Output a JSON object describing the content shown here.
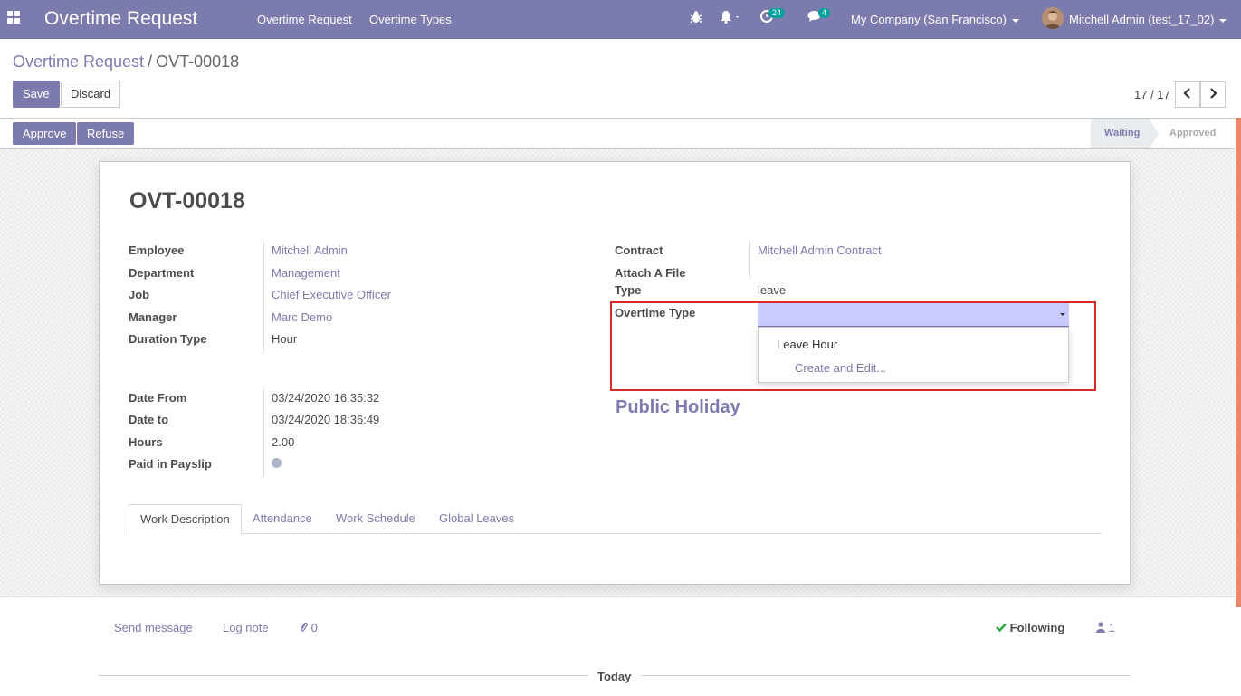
{
  "navbar": {
    "app_title": "Overtime Request",
    "menu": [
      "Overtime Request",
      "Overtime Types"
    ],
    "activities_count": "24",
    "messages_count": "4",
    "company": "My Company (San Francisco)",
    "user": "Mitchell Admin (test_17_02)",
    "bg_color": "#7c7bad"
  },
  "breadcrumb": {
    "parent": "Overtime Request",
    "separator": "/",
    "current": "OVT-00018"
  },
  "actions": {
    "save": "Save",
    "discard": "Discard"
  },
  "pager": {
    "value": "17 / 17"
  },
  "statusbar": {
    "approve": "Approve",
    "refuse": "Refuse",
    "stages": [
      "Waiting",
      "Approved"
    ],
    "active_stage": "Waiting"
  },
  "record": {
    "name": "OVT-00018",
    "left_fields": [
      {
        "label": "Employee",
        "value": "Mitchell Admin",
        "link": true
      },
      {
        "label": "Department",
        "value": "Management",
        "link": true
      },
      {
        "label": "Job",
        "value": "Chief Executive Officer",
        "link": true
      },
      {
        "label": "Manager",
        "value": "Marc Demo",
        "link": true
      },
      {
        "label": "Duration Type",
        "value": "Hour",
        "link": false
      }
    ],
    "date_fields": [
      {
        "label": "Date From",
        "value": "03/24/2020 16:35:32"
      },
      {
        "label": "Date to",
        "value": "03/24/2020 18:36:49"
      },
      {
        "label": "Hours",
        "value": "2.00"
      },
      {
        "label": "Paid in Payslip",
        "value": ""
      }
    ],
    "right_fields": [
      {
        "label": "Contract",
        "value": "Mitchell Admin Contract",
        "link": true
      },
      {
        "label": "Attach A File",
        "value": "",
        "link": false
      },
      {
        "label": "Type",
        "value": "leave",
        "link": false
      }
    ],
    "overtime_type": {
      "label": "Overtime Type",
      "value": "",
      "options": [
        "Leave Hour"
      ],
      "create_edit": "Create and Edit..."
    },
    "public_holiday": "Public Holiday",
    "tabs": [
      "Work Description",
      "Attendance",
      "Work Schedule",
      "Global Leaves"
    ],
    "active_tab": "Work Description"
  },
  "chatter": {
    "send_message": "Send message",
    "log_note": "Log note",
    "attachments": "0",
    "following": "Following",
    "followers": "1",
    "today": "Today"
  }
}
